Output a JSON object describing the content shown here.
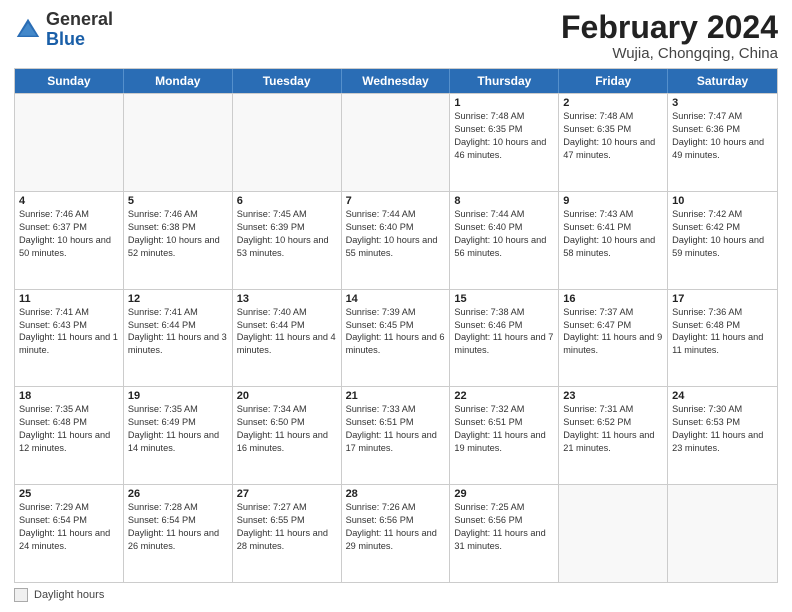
{
  "header": {
    "logo_general": "General",
    "logo_blue": "Blue",
    "month_year": "February 2024",
    "location": "Wujia, Chongqing, China"
  },
  "calendar": {
    "days_of_week": [
      "Sunday",
      "Monday",
      "Tuesday",
      "Wednesday",
      "Thursday",
      "Friday",
      "Saturday"
    ],
    "rows": [
      [
        {
          "day": "",
          "sunrise": "",
          "sunset": "",
          "daylight": "",
          "empty": true
        },
        {
          "day": "",
          "sunrise": "",
          "sunset": "",
          "daylight": "",
          "empty": true
        },
        {
          "day": "",
          "sunrise": "",
          "sunset": "",
          "daylight": "",
          "empty": true
        },
        {
          "day": "",
          "sunrise": "",
          "sunset": "",
          "daylight": "",
          "empty": true
        },
        {
          "day": "1",
          "sunrise": "Sunrise: 7:48 AM",
          "sunset": "Sunset: 6:35 PM",
          "daylight": "Daylight: 10 hours and 46 minutes."
        },
        {
          "day": "2",
          "sunrise": "Sunrise: 7:48 AM",
          "sunset": "Sunset: 6:35 PM",
          "daylight": "Daylight: 10 hours and 47 minutes."
        },
        {
          "day": "3",
          "sunrise": "Sunrise: 7:47 AM",
          "sunset": "Sunset: 6:36 PM",
          "daylight": "Daylight: 10 hours and 49 minutes."
        }
      ],
      [
        {
          "day": "4",
          "sunrise": "Sunrise: 7:46 AM",
          "sunset": "Sunset: 6:37 PM",
          "daylight": "Daylight: 10 hours and 50 minutes."
        },
        {
          "day": "5",
          "sunrise": "Sunrise: 7:46 AM",
          "sunset": "Sunset: 6:38 PM",
          "daylight": "Daylight: 10 hours and 52 minutes."
        },
        {
          "day": "6",
          "sunrise": "Sunrise: 7:45 AM",
          "sunset": "Sunset: 6:39 PM",
          "daylight": "Daylight: 10 hours and 53 minutes."
        },
        {
          "day": "7",
          "sunrise": "Sunrise: 7:44 AM",
          "sunset": "Sunset: 6:40 PM",
          "daylight": "Daylight: 10 hours and 55 minutes."
        },
        {
          "day": "8",
          "sunrise": "Sunrise: 7:44 AM",
          "sunset": "Sunset: 6:40 PM",
          "daylight": "Daylight: 10 hours and 56 minutes."
        },
        {
          "day": "9",
          "sunrise": "Sunrise: 7:43 AM",
          "sunset": "Sunset: 6:41 PM",
          "daylight": "Daylight: 10 hours and 58 minutes."
        },
        {
          "day": "10",
          "sunrise": "Sunrise: 7:42 AM",
          "sunset": "Sunset: 6:42 PM",
          "daylight": "Daylight: 10 hours and 59 minutes."
        }
      ],
      [
        {
          "day": "11",
          "sunrise": "Sunrise: 7:41 AM",
          "sunset": "Sunset: 6:43 PM",
          "daylight": "Daylight: 11 hours and 1 minute."
        },
        {
          "day": "12",
          "sunrise": "Sunrise: 7:41 AM",
          "sunset": "Sunset: 6:44 PM",
          "daylight": "Daylight: 11 hours and 3 minutes."
        },
        {
          "day": "13",
          "sunrise": "Sunrise: 7:40 AM",
          "sunset": "Sunset: 6:44 PM",
          "daylight": "Daylight: 11 hours and 4 minutes."
        },
        {
          "day": "14",
          "sunrise": "Sunrise: 7:39 AM",
          "sunset": "Sunset: 6:45 PM",
          "daylight": "Daylight: 11 hours and 6 minutes."
        },
        {
          "day": "15",
          "sunrise": "Sunrise: 7:38 AM",
          "sunset": "Sunset: 6:46 PM",
          "daylight": "Daylight: 11 hours and 7 minutes."
        },
        {
          "day": "16",
          "sunrise": "Sunrise: 7:37 AM",
          "sunset": "Sunset: 6:47 PM",
          "daylight": "Daylight: 11 hours and 9 minutes."
        },
        {
          "day": "17",
          "sunrise": "Sunrise: 7:36 AM",
          "sunset": "Sunset: 6:48 PM",
          "daylight": "Daylight: 11 hours and 11 minutes."
        }
      ],
      [
        {
          "day": "18",
          "sunrise": "Sunrise: 7:35 AM",
          "sunset": "Sunset: 6:48 PM",
          "daylight": "Daylight: 11 hours and 12 minutes."
        },
        {
          "day": "19",
          "sunrise": "Sunrise: 7:35 AM",
          "sunset": "Sunset: 6:49 PM",
          "daylight": "Daylight: 11 hours and 14 minutes."
        },
        {
          "day": "20",
          "sunrise": "Sunrise: 7:34 AM",
          "sunset": "Sunset: 6:50 PM",
          "daylight": "Daylight: 11 hours and 16 minutes."
        },
        {
          "day": "21",
          "sunrise": "Sunrise: 7:33 AM",
          "sunset": "Sunset: 6:51 PM",
          "daylight": "Daylight: 11 hours and 17 minutes."
        },
        {
          "day": "22",
          "sunrise": "Sunrise: 7:32 AM",
          "sunset": "Sunset: 6:51 PM",
          "daylight": "Daylight: 11 hours and 19 minutes."
        },
        {
          "day": "23",
          "sunrise": "Sunrise: 7:31 AM",
          "sunset": "Sunset: 6:52 PM",
          "daylight": "Daylight: 11 hours and 21 minutes."
        },
        {
          "day": "24",
          "sunrise": "Sunrise: 7:30 AM",
          "sunset": "Sunset: 6:53 PM",
          "daylight": "Daylight: 11 hours and 23 minutes."
        }
      ],
      [
        {
          "day": "25",
          "sunrise": "Sunrise: 7:29 AM",
          "sunset": "Sunset: 6:54 PM",
          "daylight": "Daylight: 11 hours and 24 minutes."
        },
        {
          "day": "26",
          "sunrise": "Sunrise: 7:28 AM",
          "sunset": "Sunset: 6:54 PM",
          "daylight": "Daylight: 11 hours and 26 minutes."
        },
        {
          "day": "27",
          "sunrise": "Sunrise: 7:27 AM",
          "sunset": "Sunset: 6:55 PM",
          "daylight": "Daylight: 11 hours and 28 minutes."
        },
        {
          "day": "28",
          "sunrise": "Sunrise: 7:26 AM",
          "sunset": "Sunset: 6:56 PM",
          "daylight": "Daylight: 11 hours and 29 minutes."
        },
        {
          "day": "29",
          "sunrise": "Sunrise: 7:25 AM",
          "sunset": "Sunset: 6:56 PM",
          "daylight": "Daylight: 11 hours and 31 minutes."
        },
        {
          "day": "",
          "sunrise": "",
          "sunset": "",
          "daylight": "",
          "empty": true
        },
        {
          "day": "",
          "sunrise": "",
          "sunset": "",
          "daylight": "",
          "empty": true
        }
      ]
    ]
  },
  "legend": {
    "label": "Daylight hours"
  }
}
